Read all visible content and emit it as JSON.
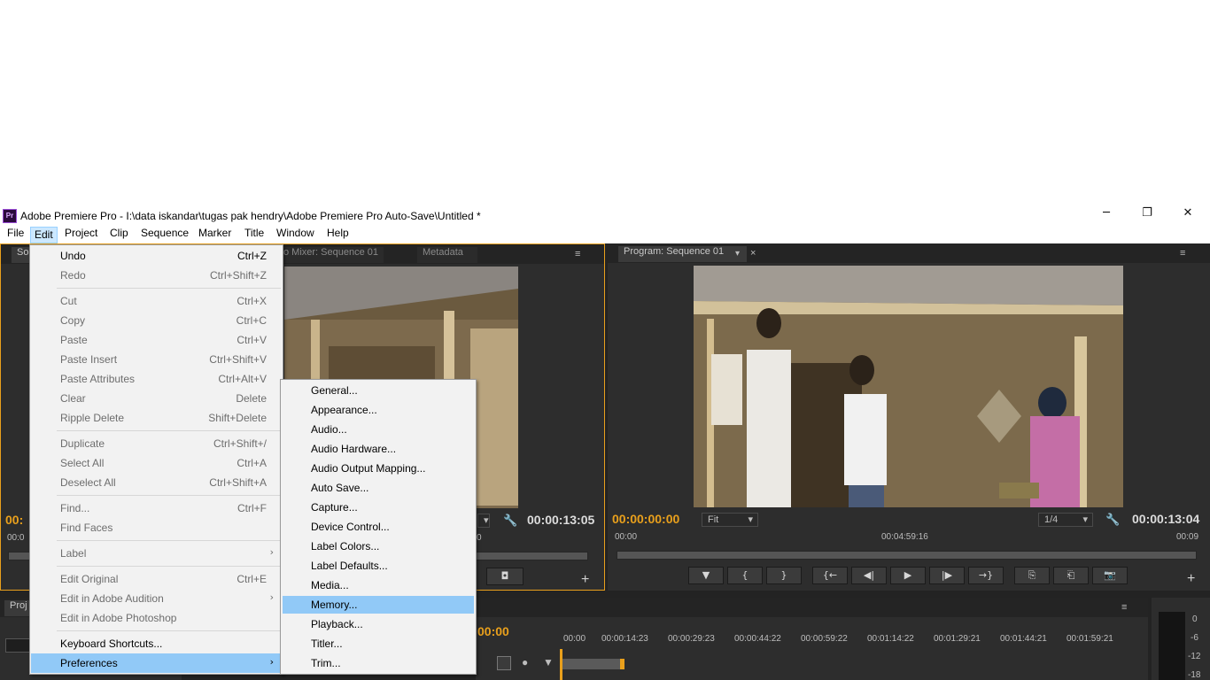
{
  "window": {
    "app_icon": "Pr",
    "title": "Adobe Premiere Pro - I:\\data iskandar\\tugas pak hendry\\Adobe Premiere Pro Auto-Save\\Untitled *",
    "minimize": "─",
    "restore": "❐",
    "close": "✕"
  },
  "menubar": [
    "File",
    "Edit",
    "Project",
    "Clip",
    "Sequence",
    "Marker",
    "Title",
    "Window",
    "Help"
  ],
  "edit_menu": [
    {
      "label": "Undo",
      "shortcut": "Ctrl+Z",
      "enabled": true
    },
    {
      "label": "Redo",
      "shortcut": "Ctrl+Shift+Z",
      "enabled": false
    },
    {
      "label": "Cut",
      "shortcut": "Ctrl+X",
      "enabled": false
    },
    {
      "label": "Copy",
      "shortcut": "Ctrl+C",
      "enabled": false
    },
    {
      "label": "Paste",
      "shortcut": "Ctrl+V",
      "enabled": false
    },
    {
      "label": "Paste Insert",
      "shortcut": "Ctrl+Shift+V",
      "enabled": false
    },
    {
      "label": "Paste Attributes",
      "shortcut": "Ctrl+Alt+V",
      "enabled": false
    },
    {
      "label": "Clear",
      "shortcut": "Delete",
      "enabled": false
    },
    {
      "label": "Ripple Delete",
      "shortcut": "Shift+Delete",
      "enabled": false
    },
    {
      "label": "Duplicate",
      "shortcut": "Ctrl+Shift+/",
      "enabled": false
    },
    {
      "label": "Select All",
      "shortcut": "Ctrl+A",
      "enabled": false
    },
    {
      "label": "Deselect All",
      "shortcut": "Ctrl+Shift+A",
      "enabled": false
    },
    {
      "label": "Find...",
      "shortcut": "Ctrl+F",
      "enabled": false
    },
    {
      "label": "Find Faces",
      "shortcut": "",
      "enabled": false
    },
    {
      "label": "Label",
      "shortcut": "",
      "enabled": false,
      "submenu": true
    },
    {
      "label": "Edit Original",
      "shortcut": "Ctrl+E",
      "enabled": false
    },
    {
      "label": "Edit in Adobe Audition",
      "shortcut": "",
      "enabled": false,
      "submenu": true
    },
    {
      "label": "Edit in Adobe Photoshop",
      "shortcut": "",
      "enabled": false
    },
    {
      "label": "Keyboard Shortcuts...",
      "shortcut": "",
      "enabled": true
    },
    {
      "label": "Preferences",
      "shortcut": "",
      "enabled": true,
      "submenu": true,
      "highlighted": true
    }
  ],
  "preferences_submenu": [
    {
      "label": "General..."
    },
    {
      "label": "Appearance..."
    },
    {
      "label": "Audio..."
    },
    {
      "label": "Audio Hardware..."
    },
    {
      "label": "Audio Output Mapping..."
    },
    {
      "label": "Auto Save..."
    },
    {
      "label": "Capture..."
    },
    {
      "label": "Device Control..."
    },
    {
      "label": "Label Colors..."
    },
    {
      "label": "Label Defaults..."
    },
    {
      "label": "Media..."
    },
    {
      "label": "Memory...",
      "highlighted": true
    },
    {
      "label": "Playback..."
    },
    {
      "label": "Titler..."
    },
    {
      "label": "Trim..."
    }
  ],
  "source_panel": {
    "tab_source": "So",
    "tab_mixer": "o Mixer: Sequence 01",
    "tab_metadata": "Metadata",
    "timecode_left": "00:",
    "timecode_right": "00:00:13:05",
    "ruler_left": "00:0",
    "ruler_right": "0"
  },
  "program_panel": {
    "tab": "Program: Sequence 01",
    "timecode_left": "00:00:00:00",
    "fit": "Fit",
    "resolution": "1/4",
    "timecode_right": "00:00:13:04",
    "ruler_start": "00:00",
    "ruler_mid": "00:04:59:16",
    "ruler_end": "00:09",
    "controls": [
      "▼",
      "{",
      "}",
      "{←",
      "◀|",
      "▶",
      "|▶",
      "→}",
      "⎘",
      "⎗",
      "📷"
    ]
  },
  "project_panel": {
    "tab": "Proj"
  },
  "timeline": {
    "timecode": "00:00",
    "ruler": [
      "00:00",
      "00:00:14:23",
      "00:00:29:23",
      "00:00:44:22",
      "00:00:59:22",
      "00:01:14:22",
      "00:01:29:21",
      "00:01:44:21",
      "00:01:59:21"
    ]
  },
  "audio_meter": {
    "labels": [
      "0",
      "-6",
      "-12",
      "-18"
    ]
  },
  "colors": {
    "timecode_yellow": "#e9a01c",
    "menu_highlight": "#91c9f7",
    "panel_bg": "#2d2d2d"
  }
}
